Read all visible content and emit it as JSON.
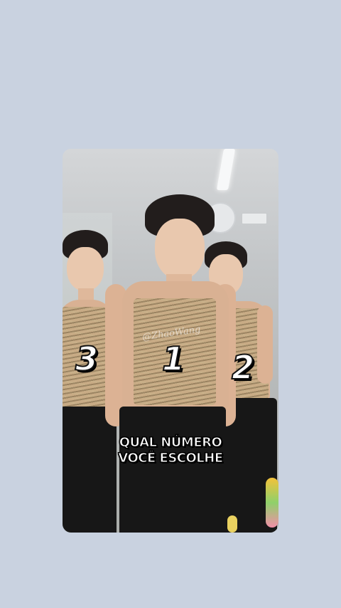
{
  "video": {
    "watermark": "@ZhaoWang",
    "numbers": {
      "left": "3",
      "center": "1",
      "right": "2"
    },
    "caption": {
      "line1": "QUAL NÚMERO",
      "line2": "VOCÊ ESCOLHE"
    }
  },
  "colors": {
    "background": "#c9d2e0",
    "caption_text": "#ffffff",
    "outline": "#000000"
  }
}
